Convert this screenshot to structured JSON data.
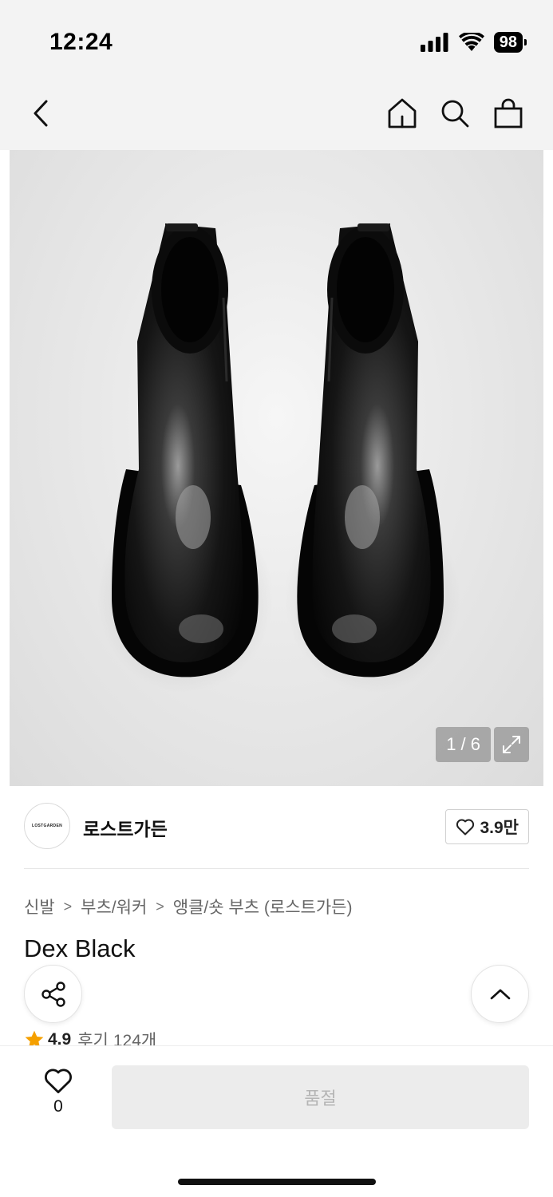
{
  "status_bar": {
    "time": "12:24",
    "battery": "98",
    "icons": [
      "signal-icon",
      "wifi-icon",
      "battery-icon"
    ]
  },
  "nav": {
    "icons": [
      "back-icon",
      "home-icon",
      "search-icon",
      "bag-icon"
    ]
  },
  "gallery": {
    "counter": "1 / 6",
    "expand_icon": "expand-icon"
  },
  "brand": {
    "logo_text": "LOSTGARDEN",
    "name": "로스트가든",
    "likes": "3.9만"
  },
  "breadcrumb": [
    "신발",
    "부츠/워커",
    "앵클/숏 부츠 (로스트가든)"
  ],
  "product": {
    "title": "Dex Black",
    "rating": "4.9",
    "review_label": "후기",
    "review_count": "124개"
  },
  "actions": {
    "share_icon": "share-icon",
    "scroll_top_icon": "chevron-up-icon"
  },
  "bottom": {
    "wish_count": "0",
    "buy_button": "품절"
  },
  "colors": {
    "star": "#f5a000",
    "soldout_bg": "#ececec",
    "soldout_text": "#b5b5b5"
  }
}
